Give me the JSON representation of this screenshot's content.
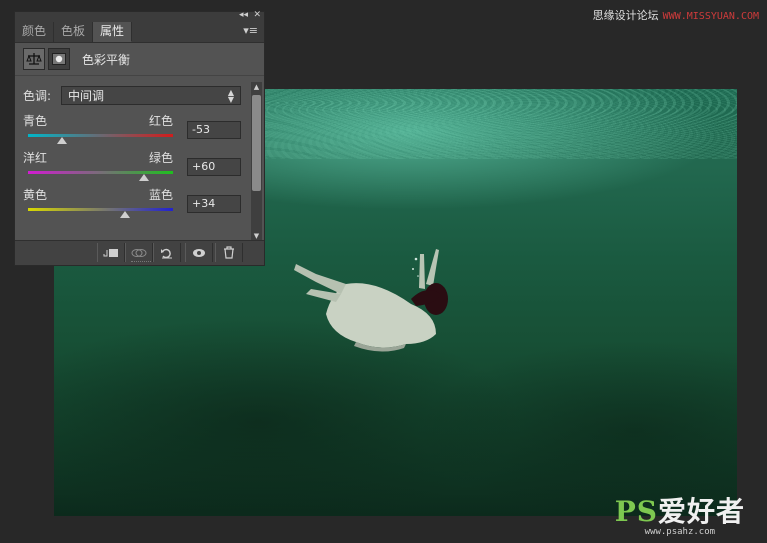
{
  "watermark": {
    "text": "思缘设计论坛",
    "url": "WWW.MISSYUAN.COM"
  },
  "logo": {
    "ps": "PS",
    "text": "爱好者",
    "url": "www.psahz.com"
  },
  "panel": {
    "tabs": [
      {
        "label": "颜色"
      },
      {
        "label": "色板"
      },
      {
        "label": "属性"
      }
    ],
    "header_title": "色彩平衡",
    "tone": {
      "label": "色调:",
      "value": "中间调"
    },
    "sliders": [
      {
        "left": "青色",
        "right": "红色",
        "value": "-53",
        "level": -53
      },
      {
        "left": "洋红",
        "right": "绿色",
        "value": "+60",
        "level": 60
      },
      {
        "left": "黄色",
        "right": "蓝色",
        "value": "+34",
        "level": 34
      }
    ],
    "colors": {
      "cyan_red": [
        "#00b6c9",
        "#d21c1c"
      ],
      "magenta_green": [
        "#d21bd2",
        "#1ec01e"
      ],
      "yellow_blue": [
        "#d8d800",
        "#2222d0"
      ]
    }
  }
}
